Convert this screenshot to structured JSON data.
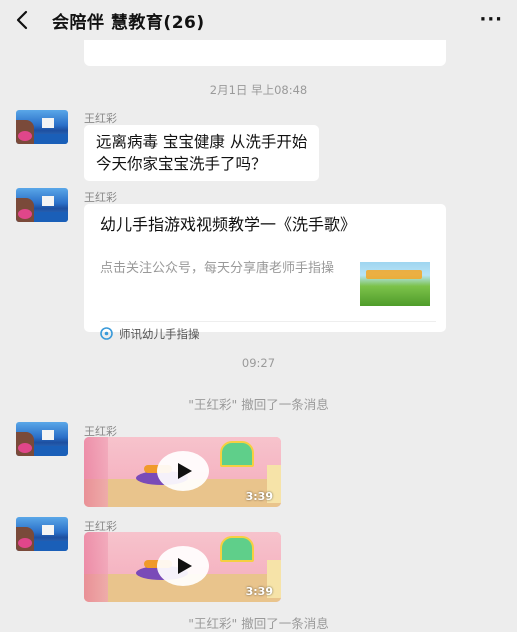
{
  "header": {
    "title": "会陪伴 慧教育(26)",
    "more_label": "···"
  },
  "messages": {
    "timestamp1": "2月1日 早上08:48",
    "sender1": "王红彩",
    "text1_line1": "远离病毒 宝宝健康  从洗手开始",
    "text1_line2": "今天你家宝宝洗手了吗？",
    "sender2": "王红彩",
    "link": {
      "title": "幼儿手指游戏视频教学一《洗手歌》",
      "description": "点击关注公众号，每天分享唐老师手指操",
      "thumbnail_caption": "",
      "source": "师讯幼儿手指操"
    },
    "timestamp2": "09:27",
    "recall1": "\"王红彩\" 撤回了一条消息",
    "sender3": "王红彩",
    "video1_duration": "3:39",
    "sender4": "王红彩",
    "video2_duration": "3:39",
    "recall2": "\"王红彩\" 撤回了一条消息"
  },
  "colors": {
    "background": "#ededed",
    "bubble": "#ffffff",
    "meta_text": "#9a9a9a",
    "source_icon": "#3a9ad9"
  }
}
